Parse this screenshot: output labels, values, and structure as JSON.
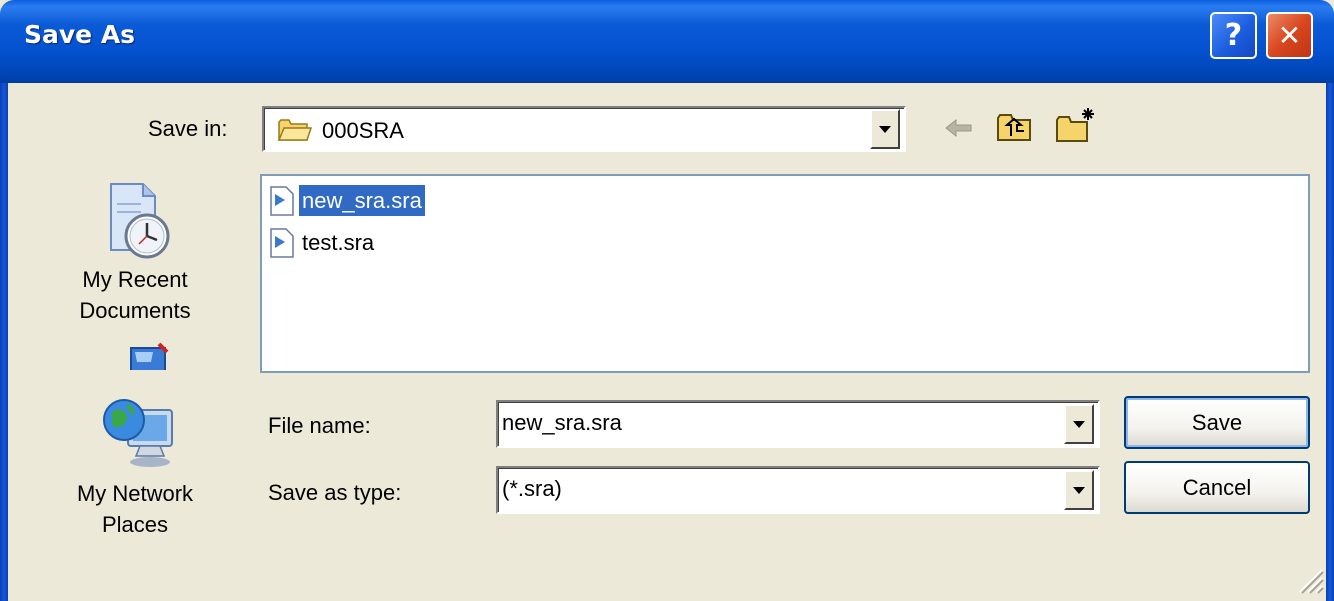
{
  "window": {
    "title": "Save As"
  },
  "titlebar_buttons": {
    "help": "?",
    "close": "✕"
  },
  "save_in": {
    "label": "Save in:",
    "value": "000SRA"
  },
  "toolbar": {
    "icons": [
      "back-arrow-icon",
      "up-one-level-icon",
      "new-folder-icon"
    ]
  },
  "places": [
    {
      "label_lines": [
        "My Recent",
        "Documents"
      ],
      "icon": "recent-documents-icon"
    },
    {
      "label_lines": [],
      "icon": "desktop-icon"
    },
    {
      "label_lines": [
        "My Network",
        "Places"
      ],
      "icon": "network-places-icon"
    }
  ],
  "files": [
    {
      "name": "new_sra.sra",
      "selected": true
    },
    {
      "name": "test.sra",
      "selected": false
    }
  ],
  "file_name": {
    "label": "File name:",
    "value": "new_sra.sra"
  },
  "save_as_type": {
    "label": "Save as type:",
    "value": "(*.sra)"
  },
  "buttons": {
    "save": "Save",
    "cancel": "Cancel"
  },
  "colors": {
    "titlebar": "#0554d3",
    "selection": "#316ac5",
    "face": "#ece9d8"
  }
}
